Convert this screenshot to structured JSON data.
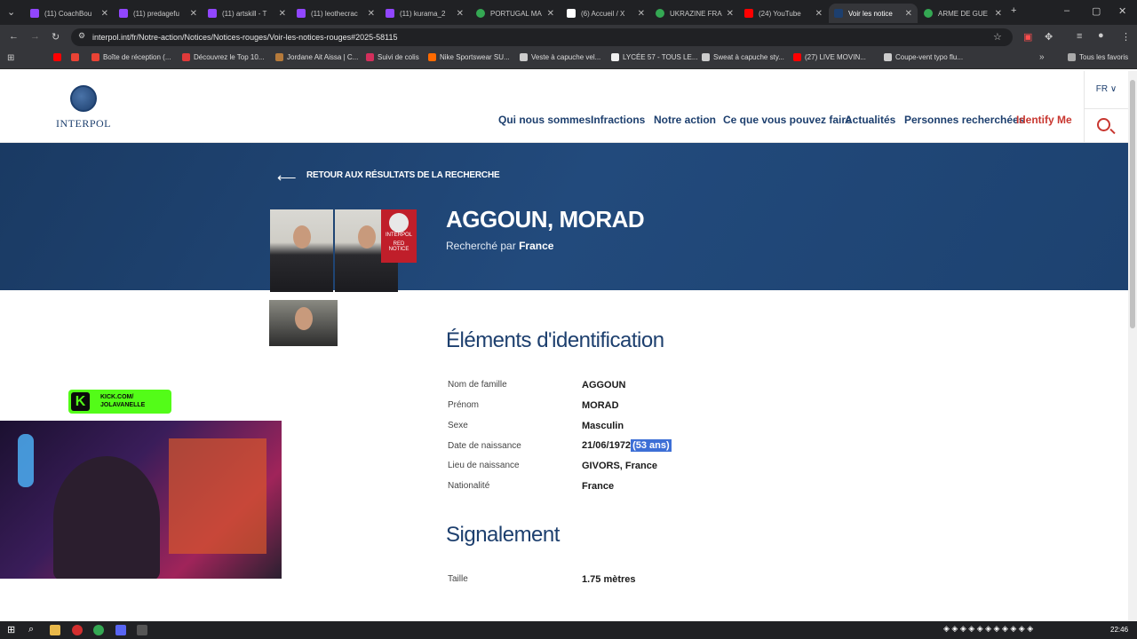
{
  "browser": {
    "tabs": [
      {
        "label": "(11) CoachBou",
        "color": "#9146ff"
      },
      {
        "label": "(11) predagefu",
        "color": "#9146ff"
      },
      {
        "label": "(11) artskill - T",
        "color": "#9146ff"
      },
      {
        "label": "(11) leothecrac",
        "color": "#9146ff"
      },
      {
        "label": "(11) kurama_2",
        "color": "#9146ff"
      },
      {
        "label": "PORTUGAL MA",
        "color": "#34a853"
      },
      {
        "label": "(6) Accueil / X",
        "color": "#ffffff"
      },
      {
        "label": "UKRAZINE FRA",
        "color": "#34a853"
      },
      {
        "label": "(24) YouTube",
        "color": "#ff0000"
      },
      {
        "label": "Voir les notice",
        "color": "#1d3f6e"
      },
      {
        "label": "ARME DE GUE",
        "color": "#34a853"
      }
    ],
    "url": "interpol.int/fr/Notre-action/Notices/Notices-rouges/Voir-les-notices-rouges#2025-58115",
    "bookmarks": [
      "Boîte de réception (...",
      "Découvrez le Top 10...",
      "Jordane Ait Aissa | C...",
      "Suivi de colis",
      "Nike Sportswear SU...",
      "Veste à capuche vel...",
      "LYCÉE 57 - TOUS LE...",
      "Sweat à capuche sty...",
      "(27) LIVE MOVIN...",
      "Coupe-vent typo flu..."
    ],
    "all_bookmarks": "Tous les favoris"
  },
  "site": {
    "logo_text": "INTERPOL",
    "nav": [
      "Qui nous sommes",
      "Infractions",
      "Notre action",
      "Ce que vous pouvez faire",
      "Actualités",
      "Personnes recherchées",
      "Identify Me"
    ],
    "lang": "FR ∨"
  },
  "notice": {
    "back_label": "RETOUR AUX RÉSULTATS DE LA RECHERCHE",
    "name": "AGGOUN, MORAD",
    "wanted_prefix": "Recherché par",
    "wanted_by": "France",
    "red_notice_line1": "INTERPOL",
    "red_notice_line2": "RED",
    "red_notice_line3": "NOTICE"
  },
  "identification": {
    "title": "Éléments d'identification",
    "rows": [
      {
        "label": "Nom de famille",
        "value": "AGGOUN"
      },
      {
        "label": "Prénom",
        "value": "MORAD"
      },
      {
        "label": "Sexe",
        "value": "Masculin"
      },
      {
        "label": "Date de naissance",
        "value": "21/06/1972",
        "extra": "(53 ans)"
      },
      {
        "label": "Lieu de naissance",
        "value": "GIVORS, France"
      },
      {
        "label": "Nationalité",
        "value": "France"
      }
    ]
  },
  "signalement": {
    "title": "Signalement",
    "rows": [
      {
        "label": "Taille",
        "value": "1.75 mètres"
      }
    ]
  },
  "overlay": {
    "kick_line1": "KICK.COM/",
    "kick_line2": "JOLAVANELLE"
  },
  "taskbar": {
    "time": "22:46"
  }
}
